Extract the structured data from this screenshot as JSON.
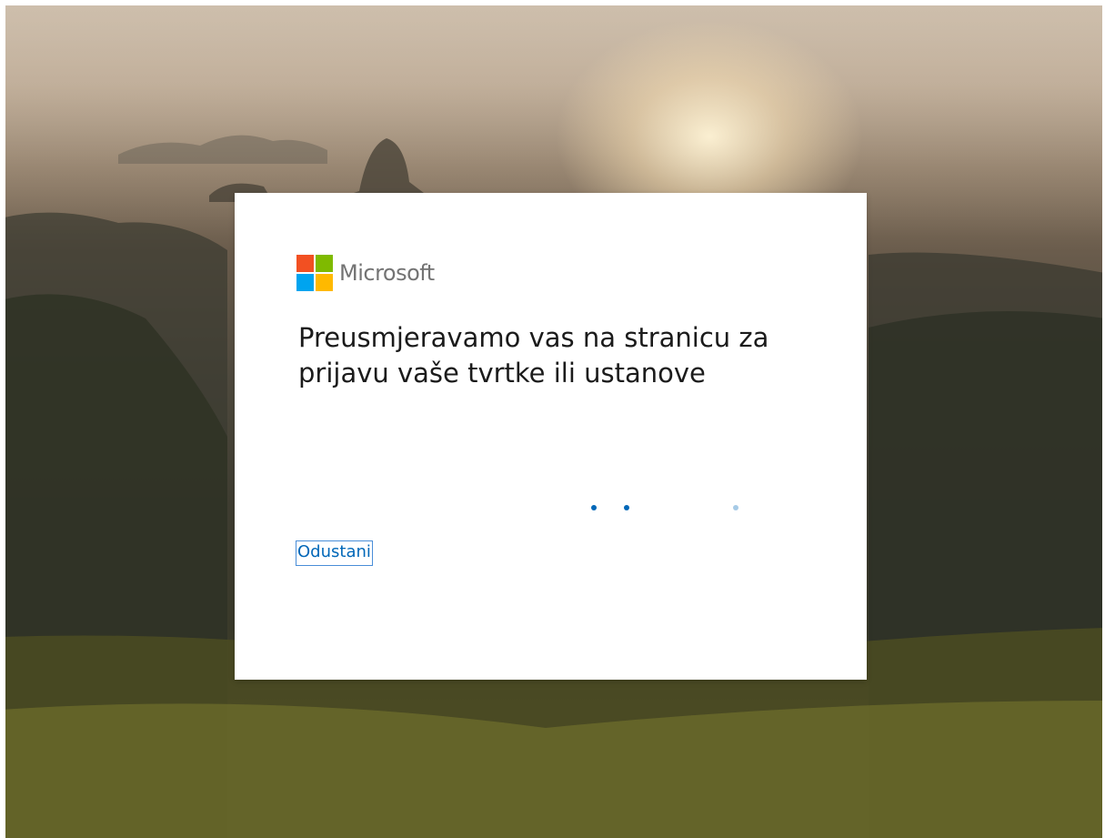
{
  "brand": {
    "name": "Microsoft",
    "logo_colors": [
      "#f25022",
      "#7fba00",
      "#00a4ef",
      "#ffb900"
    ]
  },
  "redirect": {
    "title": "Preusmjeravamo vas na stranicu za prijavu vaše tvrtke ili ustanove",
    "cancel_label": "Odustani"
  },
  "progress": {
    "accent_color": "#0067b8",
    "dots": [
      {
        "opacity": 1
      },
      {
        "opacity": 1
      },
      {
        "opacity": 0.35
      }
    ]
  }
}
